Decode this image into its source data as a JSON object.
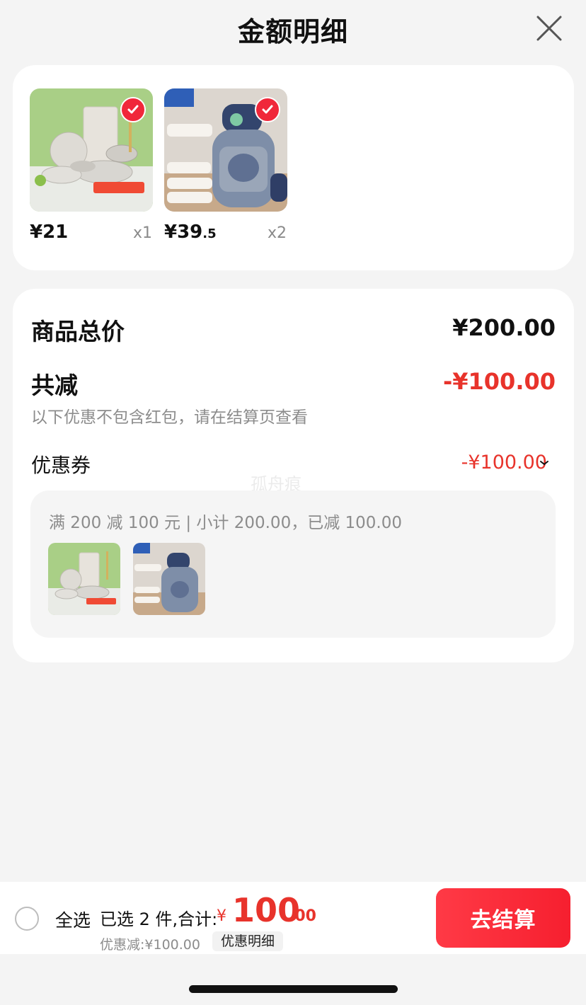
{
  "header": {
    "title": "金额明细",
    "close_icon": "close-icon"
  },
  "products": [
    {
      "price_int": "¥21",
      "price_dec": "",
      "qty": "x1",
      "checked": true,
      "image": "tableware-set"
    },
    {
      "price_int": "¥39",
      "price_dec": ".5",
      "qty": "x2",
      "checked": true,
      "image": "kids-thermos"
    }
  ],
  "summary": {
    "total_label": "商品总价",
    "total_value": "¥200.00",
    "reduce_label": "共减",
    "reduce_value": "-¥100.00",
    "note": "以下优惠不包含红包，请在结算页查看",
    "coupon_label": "优惠券",
    "coupon_value": "-¥100.00",
    "watermark": "孤舟痕",
    "coupon_desc": "满 200 减 100 元 | 小计 200.00，已减 100.00"
  },
  "bottom_bar": {
    "select_all": "全选",
    "selected_text": "已选 2 件,合计:",
    "currency": "¥",
    "total_int": "100",
    "total_dec": ".00",
    "discount_text": "优惠减:¥100.00",
    "detail_label": "优惠明细",
    "checkout_label": "去结算"
  },
  "colors": {
    "accent_red": "#e8332b",
    "button_red": "#f61f2f",
    "background": "#f4f4f4"
  }
}
